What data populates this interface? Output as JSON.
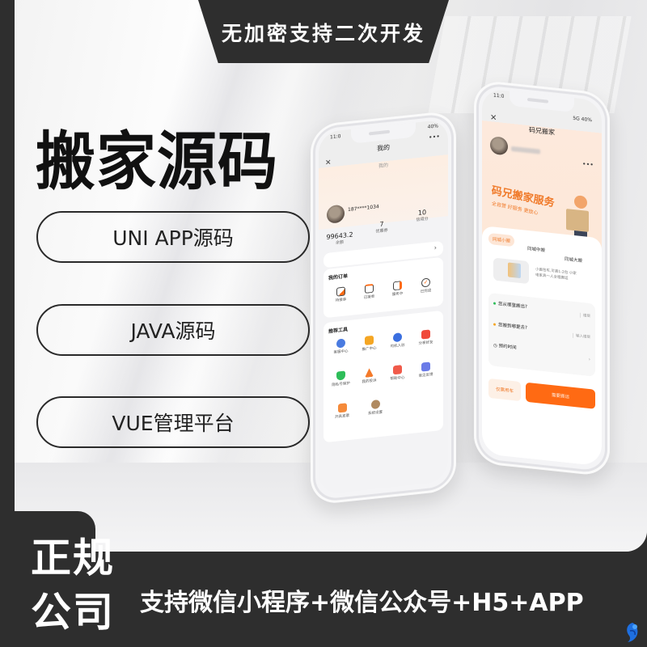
{
  "top_banner": {
    "text": "无加密支持二次开发"
  },
  "main_title": "搬家源码",
  "feature_pills": [
    {
      "label": "UNI APP源码"
    },
    {
      "label": "JAVA源码"
    },
    {
      "label": "VUE管理平台"
    }
  ],
  "bottom": {
    "badge_line1": "正规",
    "badge_line2": "公司",
    "platforms": "支持微信小程序+微信公众号+H5+APP",
    "logo_icon": "blue-swirl-logo-icon"
  },
  "colors": {
    "dark": "#2e2e2e",
    "accent_orange": "#ff6a13",
    "banner_orange": "#f07a2a",
    "peach": "#fde8d8"
  },
  "phone_left": {
    "status_time": "11:0",
    "status_right": "40%",
    "nav_title": "我的",
    "page_subtitle": "我的",
    "close_icon": "close-icon",
    "more_icon": "more-icon",
    "user_phone": "187****1034",
    "stats": [
      {
        "value": "99643.2",
        "label": "余额"
      },
      {
        "value": "7",
        "label": "优惠券"
      },
      {
        "value": "10",
        "label": "信用分"
      }
    ],
    "orders": {
      "title": "我的订单",
      "items": [
        {
          "label": "待接单",
          "icon": "order-pending-icon"
        },
        {
          "label": "已接单",
          "icon": "order-accepted-icon"
        },
        {
          "label": "服务中",
          "icon": "truck-icon"
        },
        {
          "label": "已完成",
          "icon": "check-circle-icon"
        }
      ]
    },
    "tools": {
      "title": "推荐工具",
      "items": [
        {
          "label": "客服中心",
          "icon": "robot-icon",
          "color": "#4a7be0"
        },
        {
          "label": "推广中心",
          "icon": "wallet-icon",
          "color": "#f5a623"
        },
        {
          "label": "司机入驻",
          "icon": "headset-icon",
          "color": "#3b6fe0"
        },
        {
          "label": "分享好友",
          "icon": "gift-icon",
          "color": "#f04a3a"
        },
        {
          "label": "隐私号保护",
          "icon": "shield-icon",
          "color": "#2ebd59"
        },
        {
          "label": "我的投诉",
          "icon": "warning-icon",
          "color": "#f47a2a"
        },
        {
          "label": "帮助中心",
          "icon": "help-doc-icon",
          "color": "#f05a4a"
        },
        {
          "label": "意见反馈",
          "icon": "feedback-icon",
          "color": "#6a7be8"
        },
        {
          "label": "开具发票",
          "icon": "invoice-icon",
          "color": "#f58a3a"
        },
        {
          "label": "系统设置",
          "icon": "gear-icon",
          "color": "#b08a60"
        }
      ]
    }
  },
  "phone_right": {
    "status_time": "11:0",
    "status_right": "5G 40%",
    "nav_title": "码兄搬家",
    "close_icon": "close-icon",
    "more_icon": "more-icon",
    "banner_title": "码兄搬家服务",
    "banner_subtitle": "全自营 好服务 更放心",
    "tabs": [
      {
        "label": "同城小搬",
        "active": true
      },
      {
        "label": "同城中搬",
        "active": false
      },
      {
        "label": "同城大搬",
        "active": false
      }
    ],
    "van_description": "小面包车,可装1-2包 小家电家具一人全程搬运",
    "form": {
      "from_label": "您从哪里搬出?",
      "from_hint": "楼层",
      "to_label": "您搬到哪里去?",
      "to_hint": "输入楼层",
      "time_label": "预约时间"
    },
    "secondary_button": "仅需用车",
    "primary_button": "需要搬运"
  }
}
